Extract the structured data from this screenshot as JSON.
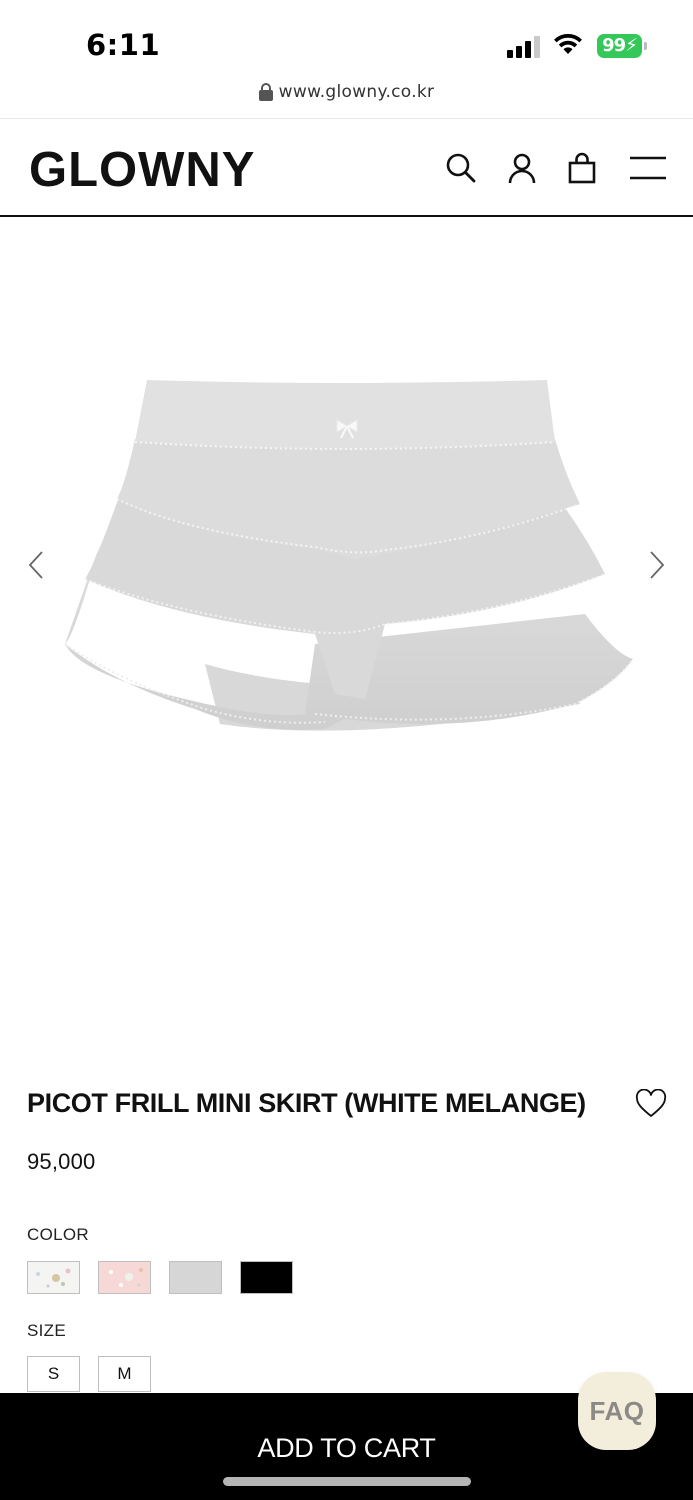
{
  "status_bar": {
    "time": "6:11",
    "battery": "99",
    "icons": [
      "cellular-signal-icon",
      "wifi-icon",
      "battery-charging-icon"
    ]
  },
  "browser": {
    "url": "www.glowny.co.kr",
    "icon": "lock-icon"
  },
  "header": {
    "logo": "GLOWNY",
    "icons": [
      "search-icon",
      "account-icon",
      "shopping-bag-icon",
      "menu-icon"
    ]
  },
  "gallery": {
    "prev_icon": "chevron-left-icon",
    "next_icon": "chevron-right-icon",
    "image": "grey-tiered-frill-mini-skirt"
  },
  "product": {
    "title": "PICOT FRILL MINI SKIRT (WHITE MELANGE)",
    "price": "95,000",
    "wishlist_icon": "heart-outline-icon"
  },
  "options": {
    "color_label": "COLOR",
    "colors": [
      {
        "name": "floral-white-swatch",
        "color": "#f4f4f2"
      },
      {
        "name": "floral-pink-swatch",
        "color": "#f6d9d6"
      },
      {
        "name": "grey-swatch",
        "color": "#d6d6d6"
      },
      {
        "name": "black-swatch",
        "color": "#000000"
      }
    ],
    "size_label": "SIZE",
    "sizes": [
      "S",
      "M"
    ]
  },
  "actions": {
    "add_to_cart": "ADD TO CART",
    "faq": "FAQ"
  },
  "colors": {
    "accent": "#000000",
    "battery_green": "#34c759",
    "faq_bg": "#f3eedc"
  }
}
